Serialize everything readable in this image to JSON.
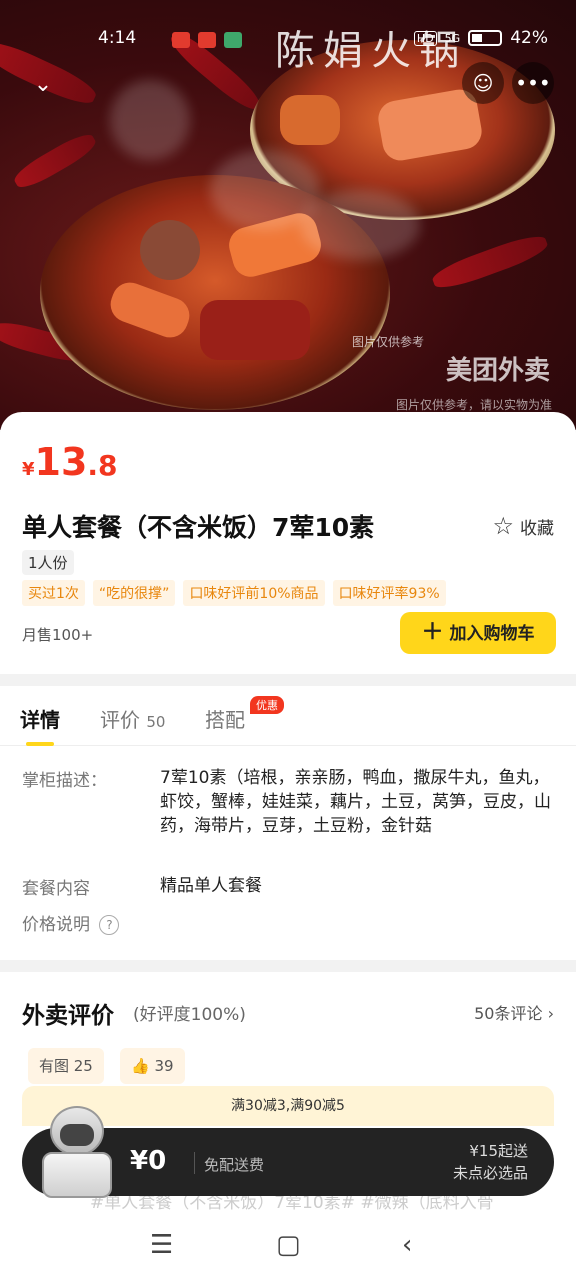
{
  "status_bar": {
    "time": "4:14",
    "battery": "42%",
    "network": "5G",
    "hd": "HD"
  },
  "hero": {
    "shop_sign": "陈娟火锅",
    "watermark_small": "图片仅供参考",
    "watermark_brand": "美团外卖",
    "watermark_note": "图片仅供参考，请以实物为准"
  },
  "actions": {
    "back_icon": "chevron-down",
    "service_icon": "headset",
    "more_icon": "more-dots"
  },
  "product": {
    "price_symbol": "¥",
    "price_integer": "13",
    "price_decimal": ".8",
    "title": "单人套餐（不含米饭）7荤10素",
    "favorite_label": "收藏",
    "portion": "1人份",
    "tags": [
      "买过1次",
      "“吃的很撑”",
      "口味好评前10%商品",
      "口味好评率93%"
    ],
    "monthly_sales": "月售100+",
    "add_cart_label": "加入购物车"
  },
  "tabs": {
    "details": "详情",
    "reviews": "评价",
    "reviews_count": "50",
    "combo": "搭配",
    "combo_badge": "优惠"
  },
  "details": {
    "desc_label": "掌柜描述：",
    "desc_value": "7荤10素（培根，亲亲肠，鸭血，撒尿牛丸，鱼丸，虾饺，蟹棒，娃娃菜，藕片，土豆，莴笋，豆皮，山药，海带片，豆芽，土豆粉，金针菇",
    "content_label": "套餐内容",
    "content_value": "精品单人套餐",
    "price_note_label": "价格说明"
  },
  "reviews": {
    "title": "外卖评价",
    "rating_text": "(好评度100%)",
    "count_link": "50条评论",
    "chip_photo": "有图 25",
    "chip_like": "39",
    "promo": "满30减3,满90减5",
    "faded_review": "#单人套餐（不含米饭）7荤10素# #微辣（底料入骨"
  },
  "cart": {
    "amount": "¥0",
    "delivery": "免配送费",
    "min_order": "¥15起送",
    "required_note": "未点必选品"
  },
  "colors": {
    "accent": "#ffd61a",
    "price": "#f2361f",
    "tag_text": "#e8870e",
    "tag_bg": "#fff4e4"
  }
}
